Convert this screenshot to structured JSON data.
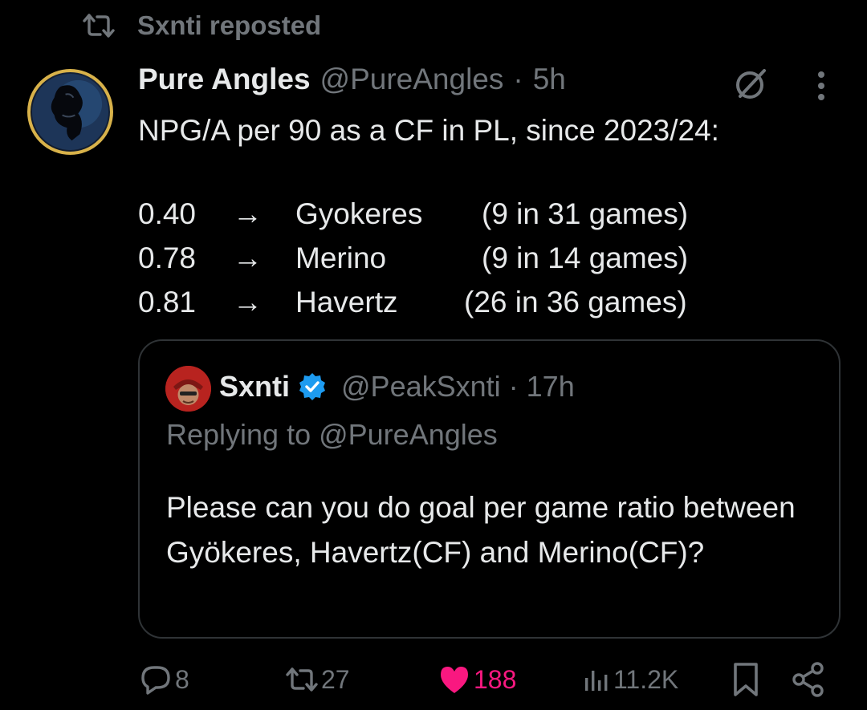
{
  "repost": {
    "label": "Sxnti reposted"
  },
  "tweet": {
    "author_name": "Pure Angles",
    "handle": "@PureAngles",
    "separator": "·",
    "time": "5h",
    "text": "NPG/A per 90 as a CF in PL, since 2023/24:",
    "arrow": "→",
    "stats": [
      {
        "value": "0.40",
        "player": "Gyokeres",
        "detail": "(9 in 31 games)"
      },
      {
        "value": "0.78",
        "player": "Merino",
        "detail": "(9 in 14 games)"
      },
      {
        "value": "0.81",
        "player": "Havertz",
        "detail": "(26 in 36 games)"
      }
    ]
  },
  "quote": {
    "author_name": "Sxnti",
    "handle": "@PeakSxnti",
    "separator": "·",
    "time": "17h",
    "replying_to": "Replying to @PureAngles",
    "text": "Please can you do goal per game ratio between Gyökeres, Havertz(CF) and Merino(CF)?"
  },
  "actions": {
    "replies": "8",
    "reposts": "27",
    "likes": "188",
    "views": "11.2K"
  },
  "icons": {
    "repost": "repost-icon",
    "grok": "grok-icon",
    "more": "more-icon",
    "verified": "verified-badge-icon",
    "reply": "reply-icon",
    "like": "heart-icon",
    "views": "views-icon",
    "bookmark": "bookmark-icon",
    "share": "share-icon"
  },
  "colors": {
    "background": "#000000",
    "text": "#e7e9ea",
    "muted": "#71767b",
    "like": "#f91880",
    "verified": "#1d9bf0",
    "border": "#2f3336"
  }
}
